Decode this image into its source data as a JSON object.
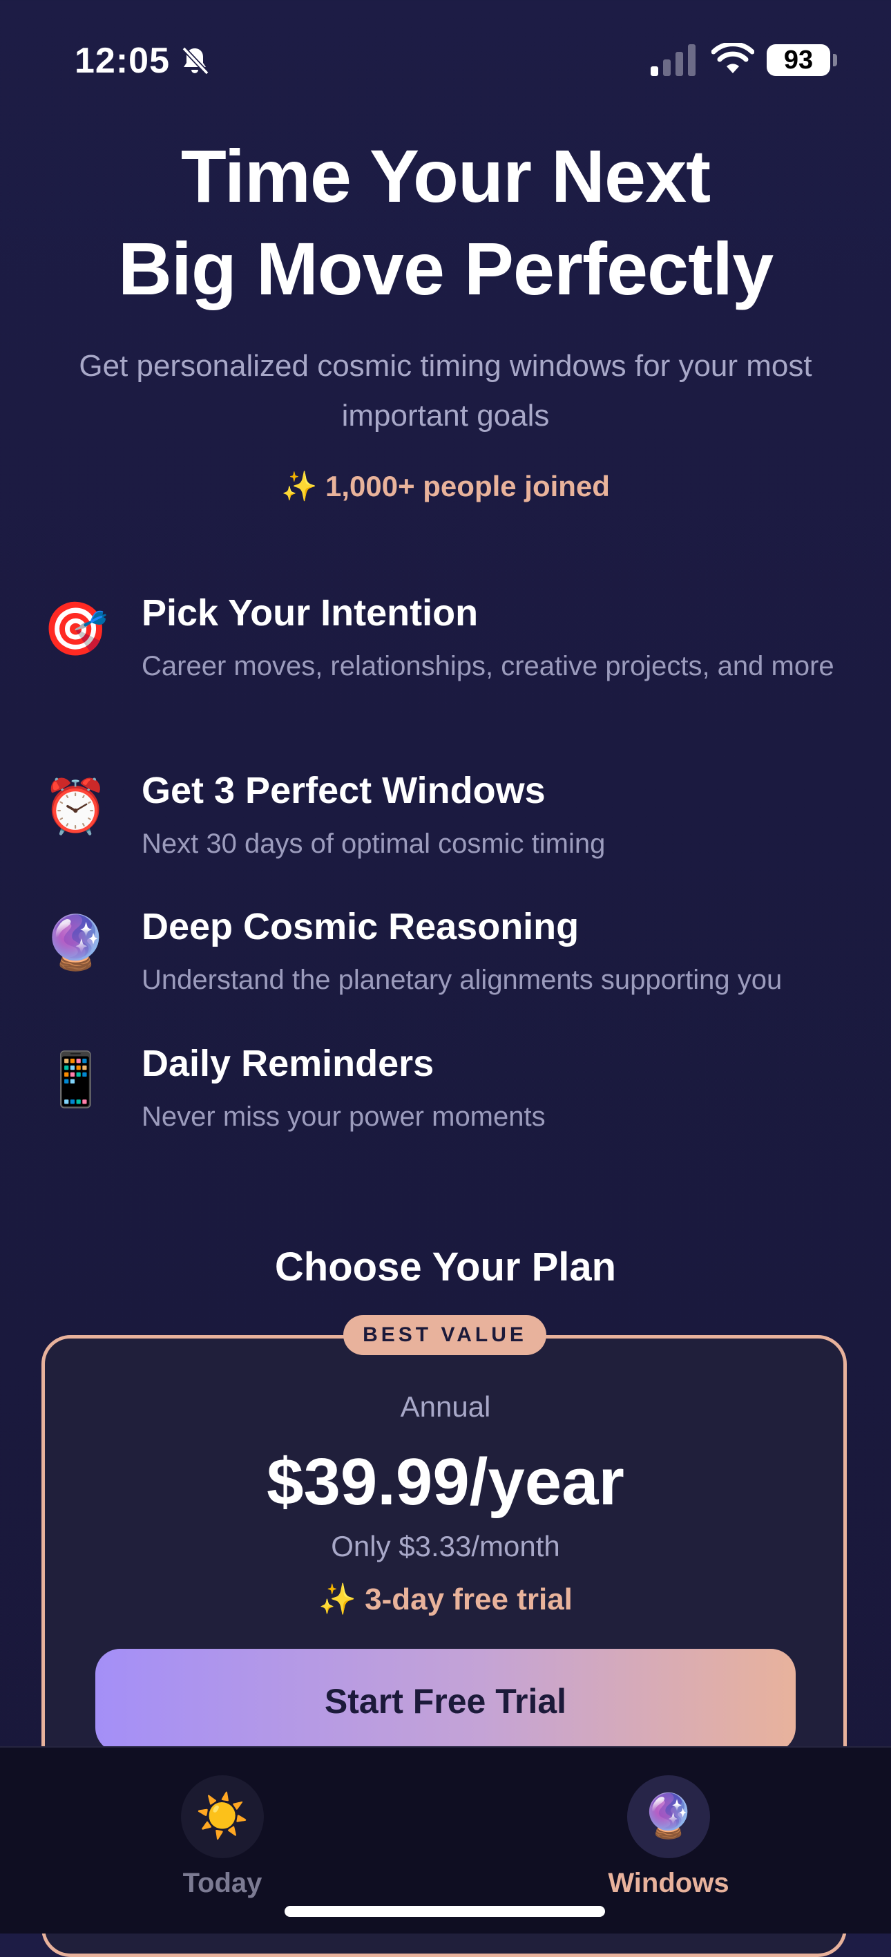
{
  "status_bar": {
    "time": "12:05",
    "battery": "93",
    "icons": [
      "bell-slash-icon",
      "cellular-signal-icon",
      "wifi-icon",
      "battery-icon"
    ]
  },
  "hero": {
    "title_line1": "Time Your Next",
    "title_line2": "Big Move Perfectly",
    "subtitle": "Get personalized cosmic timing windows for your most important goals",
    "social_proof": "✨ 1,000+ people joined"
  },
  "features": [
    {
      "icon": "🎯",
      "icon_name": "target-icon",
      "title": "Pick Your Intention",
      "description": "Career moves, relationships, creative projects, and more"
    },
    {
      "icon": "⏰",
      "icon_name": "alarm-clock-icon",
      "title": "Get 3 Perfect Windows",
      "description": "Next 30 days of optimal cosmic timing"
    },
    {
      "icon": "🔮",
      "icon_name": "crystal-ball-icon",
      "title": "Deep Cosmic Reasoning",
      "description": "Understand the planetary alignments supporting you"
    },
    {
      "icon": "📱",
      "icon_name": "mobile-phone-icon",
      "title": "Daily Reminders",
      "description": "Never miss your power moments"
    }
  ],
  "plan": {
    "heading": "Choose Your Plan",
    "badge": "BEST VALUE",
    "period": "Annual",
    "price": "$39.99/year",
    "monthly": "Only $3.33/month",
    "trial": "✨ 3-day free trial",
    "cta_label": "Start Free Trial"
  },
  "tab_bar": {
    "tabs": [
      {
        "icon": "☀️",
        "icon_name": "sun-icon",
        "label": "Today",
        "active": false
      },
      {
        "icon": "🔮",
        "icon_name": "crystal-ball-icon",
        "label": "Windows",
        "active": true
      }
    ]
  },
  "colors": {
    "background": "#1d1c45",
    "accent_peach": "#e8b29c",
    "accent_purple": "#a48ff7",
    "muted_text": "#a8a8c8",
    "tab_bar_bg": "#0f0e22"
  }
}
